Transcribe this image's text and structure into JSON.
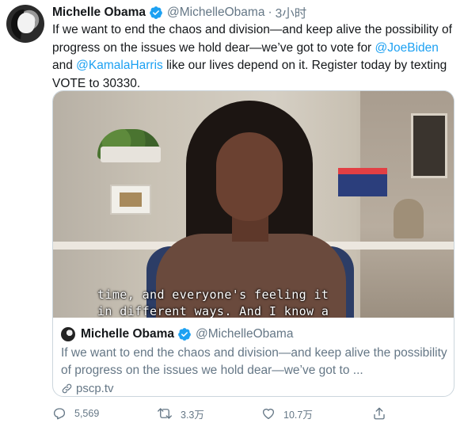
{
  "tweet": {
    "author_name": "Michelle Obama",
    "author_handle": "@MichelleObama",
    "separator": "·",
    "timestamp": "3小时",
    "text_1": "If we want to end the chaos and division—and keep alive the possibility of progress on the issues we hold dear—we’ve got to vote for ",
    "mention_1": "@JoeBiden",
    "text_2": " and ",
    "mention_2": "@KamalaHarris",
    "text_3": " like our lives depend on it. Register today by texting VOTE to 30330."
  },
  "card": {
    "subtitle_line_1": "time, and everyone's feeling it",
    "subtitle_line_2": "in different ways. And I know a",
    "author_name": "Michelle Obama",
    "author_handle": "@MichelleObama",
    "description": "If we want to end the chaos and division—and keep alive the possibility of progress on the issues we hold dear—we’ve got to ...",
    "link_domain": "pscp.tv"
  },
  "actions": {
    "replies": "5,569",
    "retweets": "3.3万",
    "likes": "10.7万"
  },
  "colors": {
    "accent": "#1da1f2",
    "muted": "#657786",
    "text": "#14171a",
    "border": "#ccd6dd"
  },
  "icons": [
    "verified-badge-icon",
    "link-icon",
    "reply-icon",
    "retweet-icon",
    "like-icon",
    "share-icon"
  ]
}
